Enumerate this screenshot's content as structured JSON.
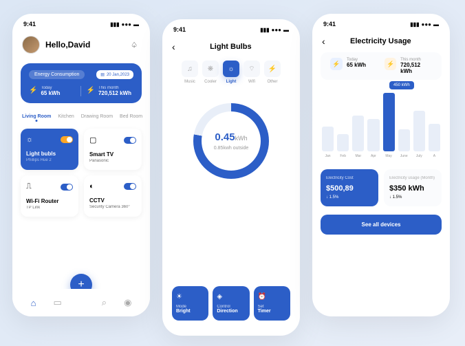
{
  "status_time": "9:41",
  "home": {
    "greeting": "Hello,David",
    "consumption_label": "Energy Consumption",
    "date": "20 Jan,2023",
    "today_label": "Today",
    "today_value": "65 kWh",
    "month_label": "This month",
    "month_value": "720,512 kWh",
    "tabs": [
      "Living Room",
      "Kitchen",
      "Drawing Room",
      "Bed Room"
    ],
    "tiles": [
      {
        "name": "Light bubls",
        "sub": "Phillips Hue 2",
        "on": true
      },
      {
        "name": "Smart TV",
        "sub": "Panasonic",
        "on": false
      },
      {
        "name": "Wi-Fi Router",
        "sub": "TP Link",
        "on": false
      },
      {
        "name": "CCTV",
        "sub": "Security Camera 360°",
        "on": false
      }
    ]
  },
  "detail": {
    "title": "Light Bulbs",
    "cats": [
      "Music",
      "Cooler",
      "Light",
      "Wifi",
      "Other"
    ],
    "gauge_value": "0.45",
    "gauge_unit": "kWh",
    "gauge_sub": "0.85kwh outside",
    "controls": [
      {
        "label": "Mode",
        "value": "Bright"
      },
      {
        "label": "Control",
        "value": "Direction"
      },
      {
        "label": "Set",
        "value": "Timer"
      }
    ]
  },
  "usage": {
    "title": "Electricity Usage",
    "today_label": "Today",
    "today_value": "65 kWh",
    "month_label": "This month",
    "month_value": "720,512 kWh",
    "tooltip": "450 kWh",
    "months": [
      "Jan",
      "Feb",
      "Mar",
      "Apr",
      "May",
      "June",
      "July",
      "A"
    ],
    "cost_label": "Electricity Cost",
    "cost_value": "$500,89",
    "cost_delta": "↓ 1.5%",
    "use_label": "Electricity usage (Month)",
    "use_value": "$350 kWh",
    "use_delta": "↓ 1.5%",
    "button": "See all devices"
  },
  "chart_data": {
    "type": "bar",
    "categories": [
      "Jan",
      "Feb",
      "Mar",
      "Apr",
      "May",
      "June",
      "July",
      "Aug"
    ],
    "values": [
      200,
      140,
      290,
      260,
      450,
      180,
      330,
      220
    ],
    "ylabel": "kWh",
    "highlight_index": 4,
    "highlight_value": 450
  }
}
